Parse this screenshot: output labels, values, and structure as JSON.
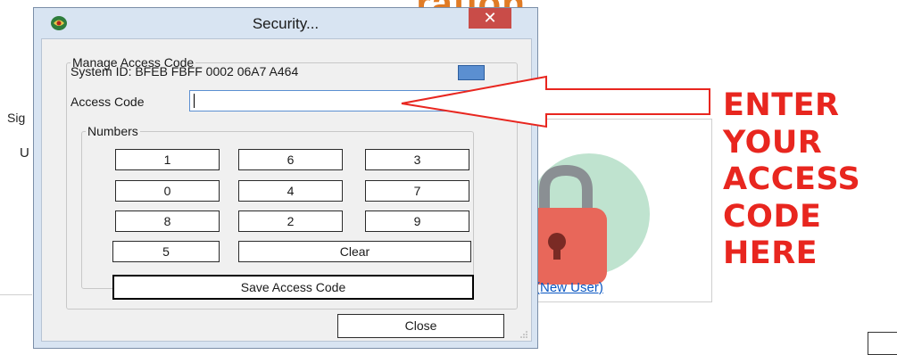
{
  "background": {
    "title_fragment": "ration",
    "sign_fragment": "Sig",
    "u_fragment": "U",
    "new_user_link": "(New User)"
  },
  "annotation": {
    "lines": [
      "ENTER",
      "YOUR",
      "ACCESS",
      "CODE",
      "HERE"
    ],
    "color": "#e8261f"
  },
  "dialog": {
    "title": "Security...",
    "close_glyph": "✕",
    "group_label": "Manage Access Code",
    "system_id_label": "System ID: BFEB FBFF 0002 06A7 A464",
    "access_code_label": "Access Code",
    "access_code_value": "",
    "numbers_label": "Numbers",
    "keypad": {
      "row1": [
        "1",
        "6",
        "3"
      ],
      "row2": [
        "0",
        "4",
        "7"
      ],
      "row3": [
        "8",
        "2",
        "9"
      ],
      "row4": [
        "5"
      ],
      "clear": "Clear"
    },
    "save_label": "Save Access Code",
    "close_label": "Close"
  },
  "colors": {
    "accent_orange": "#e07b25",
    "close_red": "#c94c48",
    "link_blue": "#0b57c2"
  }
}
